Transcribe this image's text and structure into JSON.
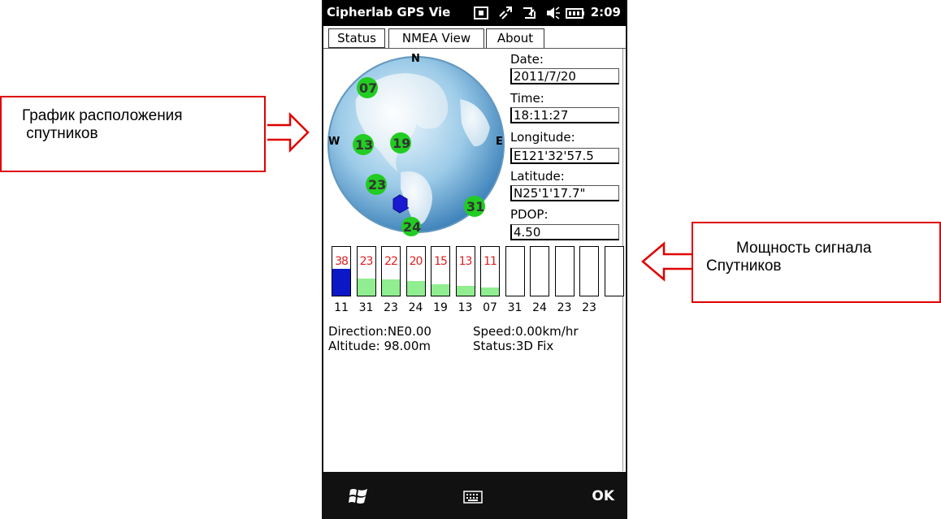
{
  "callouts": {
    "left_line1": "График расположения",
    "left_line2": " спутников",
    "right_line1": "Мощность сигнала",
    "right_line2": "Спутников"
  },
  "titlebar": {
    "title": "Cipherlab GPS Vie",
    "time": "2:09"
  },
  "tabs": [
    {
      "label": "Status"
    },
    {
      "label": "NMEA View"
    },
    {
      "label": "About"
    }
  ],
  "compass": {
    "north": "N",
    "west": "W",
    "east": "E"
  },
  "sky_satellites": [
    {
      "prn": "07",
      "color": "#22cc22"
    },
    {
      "prn": "13",
      "color": "#22cc22"
    },
    {
      "prn": "19",
      "color": "#22cc22"
    },
    {
      "prn": "23",
      "color": "#22cc22"
    },
    {
      "prn": "11",
      "color": "#1a1ad0"
    },
    {
      "prn": "31",
      "color": "#22cc22"
    },
    {
      "prn": "24",
      "color": "#22cc22"
    }
  ],
  "info": {
    "date_label": "Date:",
    "date": "2011/7/20",
    "time_label": "Time:",
    "time": "18:11:27",
    "longitude_label": "Longitude:",
    "longitude": "E121'32'57.5",
    "latitude_label": "Latitude:",
    "latitude": "N25'1'17.7\"",
    "pdop_label": "PDOP:",
    "pdop": "4.50"
  },
  "signal_bars": [
    {
      "prn": "11",
      "snr": "38",
      "level": 0.55,
      "color": "#0b18c8"
    },
    {
      "prn": "31",
      "snr": "23",
      "level": 0.35,
      "color": "#90ee90"
    },
    {
      "prn": "23",
      "snr": "22",
      "level": 0.33,
      "color": "#90ee90"
    },
    {
      "prn": "24",
      "snr": "20",
      "level": 0.3,
      "color": "#90ee90"
    },
    {
      "prn": "19",
      "snr": "15",
      "level": 0.23,
      "color": "#90ee90"
    },
    {
      "prn": "13",
      "snr": "13",
      "level": 0.2,
      "color": "#90ee90"
    },
    {
      "prn": "07",
      "snr": "11",
      "level": 0.16,
      "color": "#90ee90"
    },
    {
      "prn": "31",
      "snr": "",
      "level": 0,
      "color": "#90ee90"
    },
    {
      "prn": "24",
      "snr": "",
      "level": 0,
      "color": "#90ee90"
    },
    {
      "prn": "23",
      "snr": "",
      "level": 0,
      "color": "#90ee90"
    },
    {
      "prn": "23",
      "snr": "",
      "level": 0,
      "color": "#90ee90"
    },
    {
      "prn": "",
      "snr": "",
      "level": 0,
      "color": "#90ee90"
    }
  ],
  "status": {
    "direction_label": "Direction:",
    "direction": "NE0.00",
    "altitude_label": "Altitude:",
    "altitude": "98.00m",
    "speed_label": "Speed:",
    "speed": "0.00km/hr",
    "status_label": "Status:",
    "status": "3D Fix"
  },
  "bottom": {
    "ok": "OK"
  }
}
